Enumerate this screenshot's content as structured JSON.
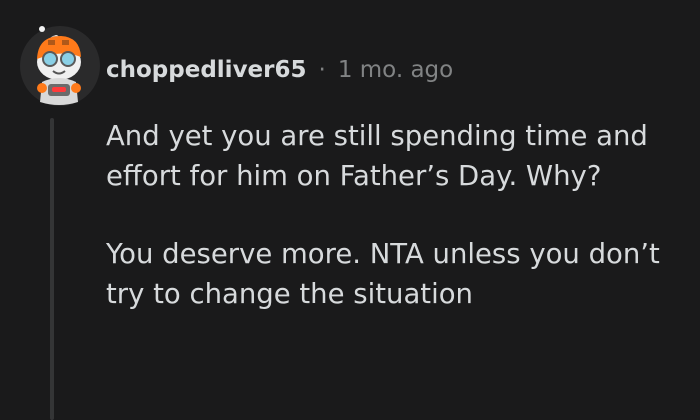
{
  "comment": {
    "username": "choppedliver65",
    "separator": "·",
    "timestamp": "1 mo. ago",
    "avatar_icon": "snoo-avatar-icon",
    "paragraphs": [
      "And yet you are still spending time and effort for him on Father’s Day. Why?",
      "You deserve more. NTA unless you don’t try to change the situation"
    ]
  },
  "colors": {
    "background": "#1a1a1b",
    "text": "#d7dadc",
    "meta": "#818384",
    "thread_line": "#343536",
    "avatar_orange": "#ff7a1a"
  }
}
